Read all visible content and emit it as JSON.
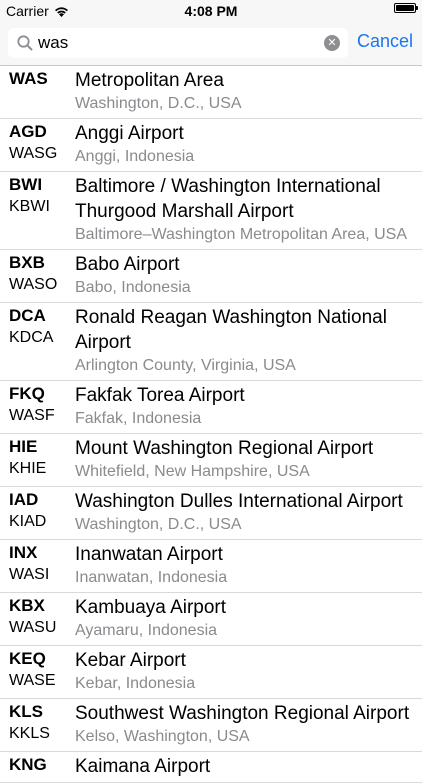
{
  "status_bar": {
    "carrier": "Carrier",
    "time": "4:08 PM",
    "wifi_icon": "wifi-icon",
    "battery_icon": "battery-icon"
  },
  "search": {
    "value": "was",
    "icon": "search-icon",
    "clear_icon": "clear-icon",
    "cancel_label": "Cancel"
  },
  "colors": {
    "accent": "#1976f0",
    "secondary_text": "#8a8a8f",
    "separator": "#d9d9dc"
  },
  "results": [
    {
      "iata": "WAS",
      "icao": "",
      "name": "Metropolitan Area",
      "location": "Washington, D.C., USA"
    },
    {
      "iata": "AGD",
      "icao": "WASG",
      "name": "Anggi Airport",
      "location": "Anggi, Indonesia"
    },
    {
      "iata": "BWI",
      "icao": "KBWI",
      "name": "Baltimore / Washington International Thurgood Marshall Airport",
      "location": "Baltimore–Washington Metropolitan Area, USA"
    },
    {
      "iata": "BXB",
      "icao": "WASO",
      "name": "Babo Airport",
      "location": "Babo, Indonesia"
    },
    {
      "iata": "DCA",
      "icao": "KDCA",
      "name": "Ronald Reagan Washington National Airport",
      "location": "Arlington County, Virginia, USA"
    },
    {
      "iata": "FKQ",
      "icao": "WASF",
      "name": "Fakfak Torea Airport",
      "location": "Fakfak, Indonesia"
    },
    {
      "iata": "HIE",
      "icao": "KHIE",
      "name": "Mount Washington Regional Airport",
      "location": "Whitefield, New Hampshire, USA"
    },
    {
      "iata": "IAD",
      "icao": "KIAD",
      "name": "Washington Dulles International Airport",
      "location": "Washington, D.C., USA"
    },
    {
      "iata": "INX",
      "icao": "WASI",
      "name": "Inanwatan Airport",
      "location": "Inanwatan, Indonesia"
    },
    {
      "iata": "KBX",
      "icao": "WASU",
      "name": "Kambuaya Airport",
      "location": "Ayamaru, Indonesia"
    },
    {
      "iata": "KEQ",
      "icao": "WASE",
      "name": "Kebar Airport",
      "location": "Kebar, Indonesia"
    },
    {
      "iata": "KLS",
      "icao": "KKLS",
      "name": "Southwest Washington Regional Airport",
      "location": "Kelso, Washington, USA"
    },
    {
      "iata": "KNG",
      "icao": "",
      "name": "Kaimana Airport",
      "location": ""
    }
  ]
}
